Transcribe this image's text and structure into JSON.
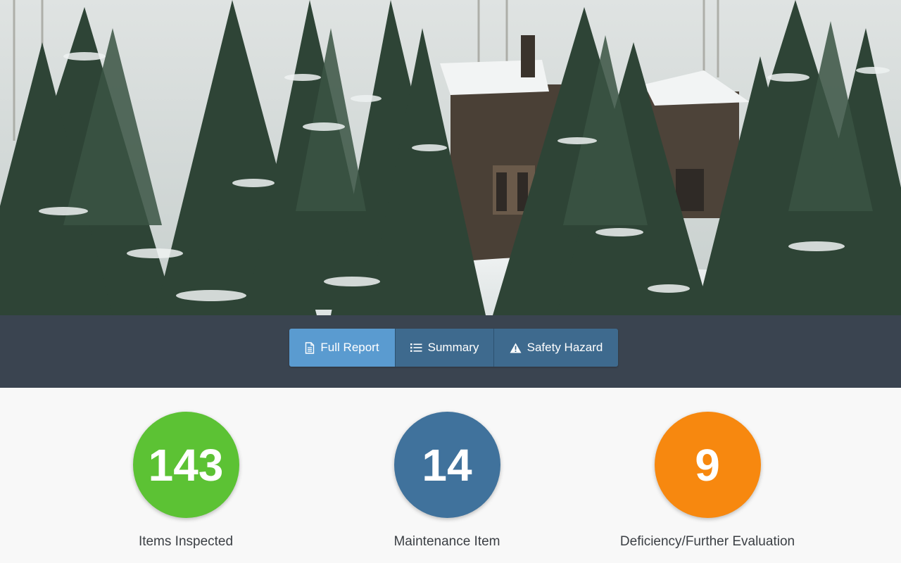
{
  "hero": {
    "image_description_icon": "snowy-forest-house-photo"
  },
  "toolbar": {
    "buttons": [
      {
        "label": "Full Report",
        "icon": "document-icon",
        "active": true
      },
      {
        "label": "Summary",
        "icon": "list-icon",
        "active": false
      },
      {
        "label": "Safety Hazard",
        "icon": "warning-icon",
        "active": false
      }
    ]
  },
  "stats": [
    {
      "value": "143",
      "label": "Items Inspected",
      "color": "#5cc234"
    },
    {
      "value": "14",
      "label": "Maintenance Item",
      "color": "#40729c"
    },
    {
      "value": "9",
      "label": "Deficiency/Further Evaluation",
      "color": "#f7880f"
    }
  ],
  "colors": {
    "toolbar_bg": "#3a4450",
    "button_bg": "#3e6a8e",
    "button_active_bg": "#5a9bd0"
  }
}
